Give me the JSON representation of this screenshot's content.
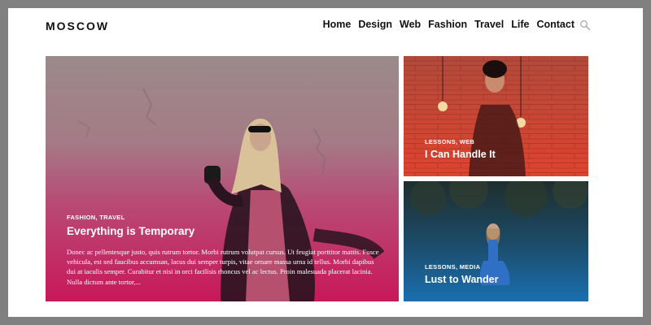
{
  "header": {
    "logo": "MOSCOW",
    "nav": [
      "Home",
      "Design",
      "Web",
      "Fashion",
      "Travel",
      "Life",
      "Contact"
    ]
  },
  "posts": {
    "main": {
      "category": "FASHION, TRAVEL",
      "title": "Everything is Temporary",
      "excerpt": "Donec ac pellentesque justo, quis rutrum tortor. Morbi rutrum volutpat cursus. Ut feugiat porttitor mattis. Fusce vehicula, est sed faucibus accumsan, lacus dui semper turpis, vitae ornare massa urna id tellus. Morbi dapibus dui at iaculis semper. Curabitur et nisi in orci facilisis rhoncus vel ac lectus. Proin malesuada placerat lacinia. Nulla dictum ante tortor,..."
    },
    "top_right": {
      "category": "LESSONS, WEB",
      "title": "I Can Handle It"
    },
    "bottom_right": {
      "category": "LESSONS, MEDIA",
      "title": "Lust to Wander"
    }
  },
  "colors": {
    "main_overlay": "#c8185a",
    "top_right_overlay": "#e0432e",
    "bottom_right_overlay": "#1a6fb0"
  }
}
